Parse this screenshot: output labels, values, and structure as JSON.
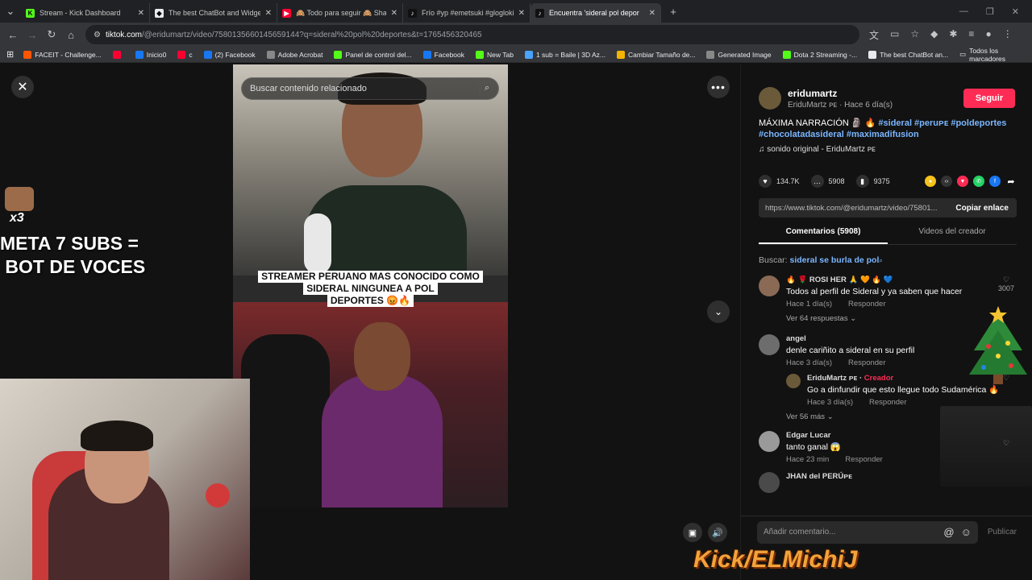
{
  "browser": {
    "tabs": [
      {
        "label": "Stream - Kick Dashboard",
        "color": "#53fc18",
        "glyph": "K",
        "active": false
      },
      {
        "label": "The best ChatBot and Widgets",
        "color": "#e8eaed",
        "glyph": "◆",
        "active": false
      },
      {
        "label": "🙈 Todo para seguir 🙈 Shaka",
        "color": "#ff0033",
        "glyph": "▶",
        "active": false
      },
      {
        "label": "Frío #yp #emetsuki #gloglokin",
        "color": "#111111",
        "glyph": "♪",
        "active": false
      },
      {
        "label": "Encuentra 'sideral pol depor",
        "color": "#111111",
        "glyph": "♪",
        "active": true
      }
    ],
    "url_host": "tiktok.com",
    "url_rest": "/@eridumartz/video/7580135660145659144?q=sideral%20pol%20deportes&t=1765456320465",
    "bookmarks": [
      {
        "label": "FACEIT - Challenge...",
        "color": "#ff5500"
      },
      {
        "label": "",
        "color": "#ff0033"
      },
      {
        "label": "Inicio0",
        "color": "#1877f2"
      },
      {
        "label": "c",
        "color": "#ff0033"
      },
      {
        "label": "(2) Facebook",
        "color": "#1877f2"
      },
      {
        "label": "Adobe Acrobat",
        "color": "#888888"
      },
      {
        "label": "Panel de control del...",
        "color": "#53fc18"
      },
      {
        "label": "Facebook",
        "color": "#1877f2"
      },
      {
        "label": "New Tab",
        "color": "#53fc18"
      },
      {
        "label": "1 sub = Baile | 3D Az...",
        "color": "#4aa3ff"
      },
      {
        "label": "Cambiar Tamaño de...",
        "color": "#f4b400"
      },
      {
        "label": "Generated Image",
        "color": "#888888"
      },
      {
        "label": "Dota 2 Streaming -...",
        "color": "#53fc18"
      },
      {
        "label": "The best ChatBot an...",
        "color": "#e8eaed"
      }
    ],
    "all_bookmarks": "Todos los marcadores"
  },
  "video": {
    "search_placeholder": "Buscar contenido relacionado",
    "caption_lines": [
      "STREAMER PERUANO MAS CONOCIDO COMO",
      "SIDERAL NINGUNEA A POL",
      "DEPORTES 😡🔥"
    ]
  },
  "overlay": {
    "goal_x": "x3",
    "goal_line1": "META 7 SUBS =",
    "goal_line2": " BOT DE VOCES",
    "brand": "Kick/ELMichiJ"
  },
  "panel": {
    "author_handle": "eridumartz",
    "author_sub": "EriduMartz ᴘᴇ · Hace 6 día(s)",
    "follow": "Seguir",
    "desc_text": "MÁXIMA NARRACIÓN 🗿 🔥 ",
    "desc_tags": "#sideral #peruᴘᴇ #poldeportes #chocolatadasideral #maximadifusion",
    "music": "♫  sonido original - EriduMartz ᴘᴇ",
    "likes": "134.7K",
    "comments_count": "5908",
    "saves": "9375",
    "link": "https://www.tiktok.com/@eridumartz/video/75801...",
    "copy": "Copiar enlace",
    "tab_comments": "Comentarios (5908)",
    "tab_creator": "Videos del creador",
    "search_prefix": "Buscar: ",
    "search_query": "sideral se burla de pol",
    "comments": [
      {
        "user": "🔥 🌹 ROSI HER 🙏 🧡 🔥 💙",
        "text": "Todos al perfil de Sideral y ya saben que hacer",
        "time": "Hace 1 día(s)",
        "reply": "Responder",
        "likes": "3007",
        "more": "Ver 64 respuestas ⌄"
      },
      {
        "user": "angel",
        "text": "denle cariñito a sideral en su perfil",
        "time": "Hace 3 día(s)",
        "reply": "Responder",
        "likes": "",
        "more": ""
      },
      {
        "user": "Edgar Lucar",
        "text": "tanto ganal 😱",
        "time": "Hace 23 min",
        "reply": "Responder",
        "likes": "",
        "more": ""
      },
      {
        "user": "JHAN del PERÚᴘᴇ",
        "text": "",
        "time": "",
        "reply": "",
        "likes": "",
        "more": ""
      }
    ],
    "creator_reply": {
      "user": "EriduMartz ᴘᴇ · ",
      "tag": "Creador",
      "text": "Go a dinfundir que esto llegue todo Sudamérica 🔥",
      "time": "Hace 3 día(s)",
      "reply": "Responder",
      "more": "Ver 56 más ⌄"
    },
    "add_placeholder": "Añadir comentario...",
    "publish": "Publicar"
  }
}
